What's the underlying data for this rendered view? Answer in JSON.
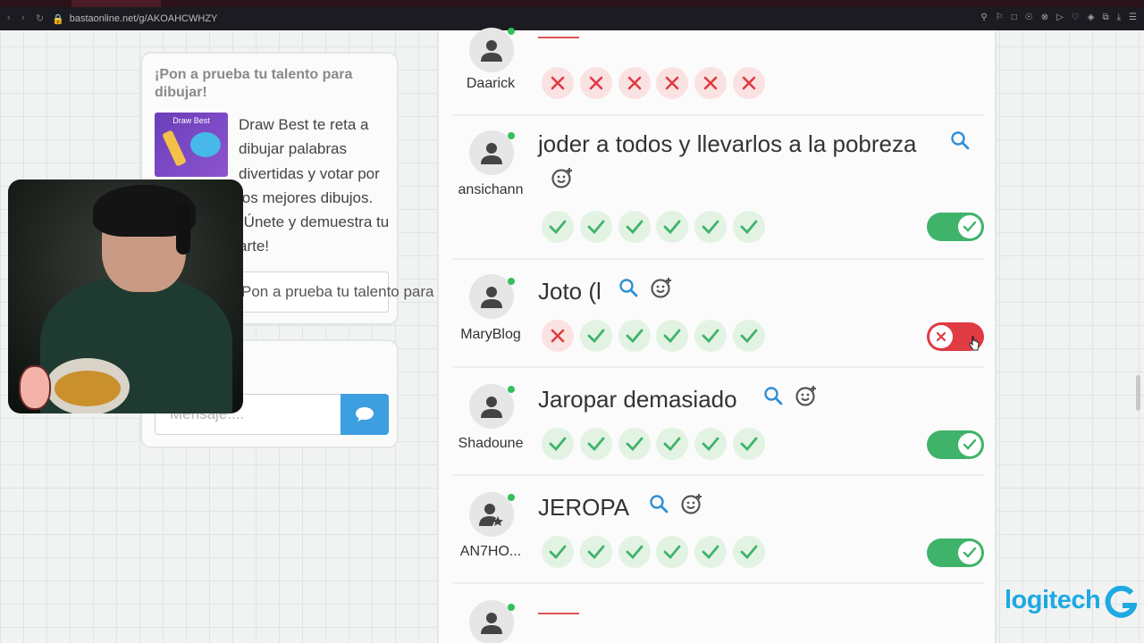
{
  "browser": {
    "url": "bastaonline.net/g/AKOAHCWHZY"
  },
  "promo": {
    "title": "¡Pon a prueba tu talento para dibujar!",
    "image_title": "Draw Best",
    "description": "Draw Best te reta a dibujar palabras divertidas y votar por los mejores dibujos. ¡Únete y demuestra tu arte!",
    "button_label": "Pon a prueba tu talento para dibujar!"
  },
  "chat": {
    "placeholder": "Mensaje...."
  },
  "rows": [
    {
      "player": "Daarick",
      "answer": "",
      "votes": [
        "no",
        "no",
        "no",
        "no",
        "no",
        "no"
      ],
      "toggle": null
    },
    {
      "player": "ansichann",
      "answer": "joder a todos y llevarlos a la pobreza",
      "votes": [
        "yes",
        "yes",
        "yes",
        "yes",
        "yes",
        "yes"
      ],
      "toggle": "on"
    },
    {
      "player": "MaryBlog",
      "answer": "Joto (l",
      "votes": [
        "no",
        "yes",
        "yes",
        "yes",
        "yes",
        "yes"
      ],
      "toggle": "off"
    },
    {
      "player": "Shadoune",
      "answer": "Jaropar demasiado",
      "votes": [
        "yes",
        "yes",
        "yes",
        "yes",
        "yes",
        "yes"
      ],
      "toggle": "on"
    },
    {
      "player": "AN7HO...",
      "answer": "JEROPA",
      "votes": [
        "yes",
        "yes",
        "yes",
        "yes",
        "yes",
        "yes"
      ],
      "toggle": "on"
    },
    {
      "player": "",
      "answer": "",
      "votes": [],
      "toggle": null
    }
  ],
  "logo": {
    "text": "logitech"
  },
  "colors": {
    "accent_blue": "#3d9ee0",
    "vote_yes": "#3fb36a",
    "vote_no": "#e03a43",
    "logo_blue": "#1ea9e3"
  }
}
